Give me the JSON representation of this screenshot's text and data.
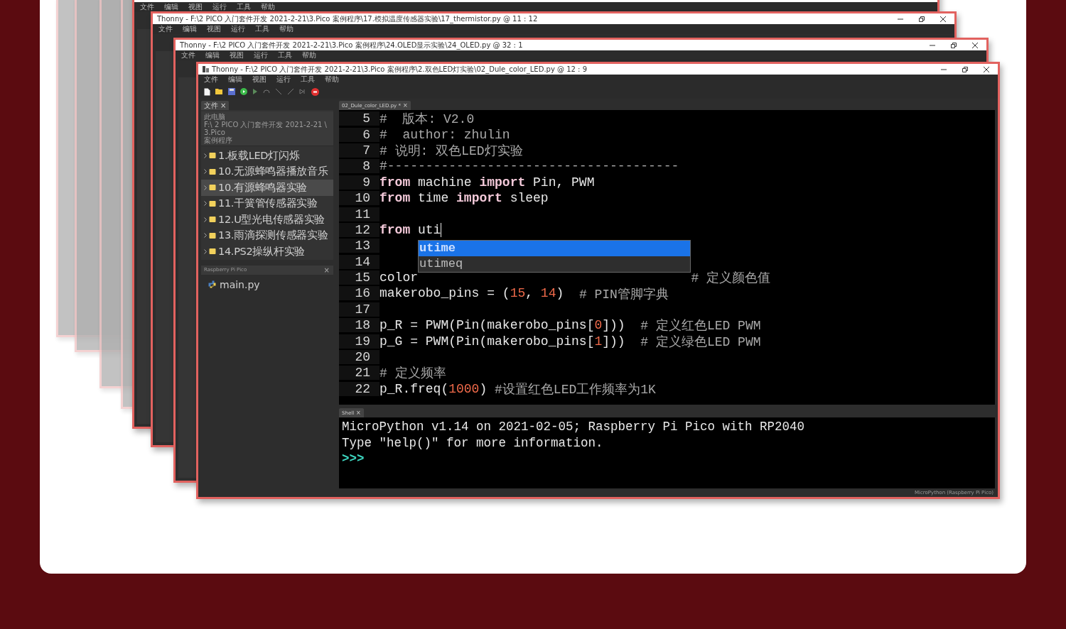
{
  "background_windows": [
    {
      "menu": [
        "文件",
        "编辑",
        "视图",
        "运行",
        "工具",
        "帮助"
      ]
    },
    {
      "title": "Thonny - F:\\2 PICO 入门套件开发 2021-2-21\\3.Pico 案例程序\\17.模拟温度传感器实验\\17_thermistor.py @ 11 : 12",
      "menu": [
        "文件",
        "编辑",
        "视图",
        "运行",
        "工具",
        "帮助"
      ]
    },
    {
      "title": "Thonny - F:\\2 PICO 入门套件开发 2021-2-21\\3.Pico 案例程序\\24.OLED显示实验\\24_OLED.py @ 32 : 1",
      "menu": [
        "文件",
        "编辑",
        "视图",
        "运行",
        "工具",
        "帮助"
      ]
    }
  ],
  "window": {
    "title": "Thonny - F:\\2 PICO 入门套件开发 2021-2-21\\3.Pico 案例程序\\2.双色LED灯实验\\02_Dule_color_LED.py @ 12 : 9",
    "menu": [
      "文件",
      "编辑",
      "视图",
      "运行",
      "工具",
      "帮助"
    ],
    "file_panel": {
      "tab": "文件",
      "close": "×",
      "location_title": "此电脑",
      "location_path": "F:\\ 2 PICO 入门套件开发 2021-2-21 \\ 3.Pico",
      "location_path_2": "案例程序",
      "items": [
        {
          "label": "1.板载LED灯闪烁",
          "selected": false
        },
        {
          "label": "10.无源蜂鸣器播放音乐",
          "selected": false
        },
        {
          "label": "10.有源蜂鸣器实验",
          "selected": true
        },
        {
          "label": "11.干簧管传感器实验",
          "selected": false
        },
        {
          "label": "12.U型光电传感器实验",
          "selected": false
        },
        {
          "label": "13.雨滴探测传感器实验",
          "selected": false
        },
        {
          "label": "14.PS2操纵杆实验",
          "selected": false
        }
      ]
    },
    "device_panel": {
      "title": "Raspberry Pi Pico",
      "close": "×",
      "files": [
        "main.py"
      ]
    },
    "editor": {
      "tab": "02_Dule_color_LED.py *",
      "close": "×",
      "lines": [
        {
          "number": "5",
          "tokens": [
            {
              "t": "#  版本: V2.0",
              "kind": "comment"
            }
          ]
        },
        {
          "number": "6",
          "tokens": [
            {
              "t": "#  author: zhulin",
              "kind": "comment"
            }
          ]
        },
        {
          "number": "7",
          "tokens": [
            {
              "t": "# 说明: 双色LED灯实验",
              "kind": "comment"
            }
          ]
        },
        {
          "number": "8",
          "tokens": [
            {
              "t": "#--------------------------------------",
              "kind": "comment"
            }
          ]
        },
        {
          "number": "9",
          "tokens": [
            {
              "t": "from",
              "kind": "keyword"
            },
            {
              "t": " machine ",
              "kind": "text"
            },
            {
              "t": "import",
              "kind": "keyword"
            },
            {
              "t": " Pin, PWM",
              "kind": "text"
            }
          ]
        },
        {
          "number": "10",
          "tokens": [
            {
              "t": "from",
              "kind": "keyword"
            },
            {
              "t": " time ",
              "kind": "text"
            },
            {
              "t": "import",
              "kind": "keyword"
            },
            {
              "t": " sleep",
              "kind": "text"
            }
          ]
        },
        {
          "number": "11"
        },
        {
          "number": "12",
          "cursor": true,
          "tokens": [
            {
              "t": "from ",
              "kind": "keyword"
            },
            {
              "t": "uti",
              "kind": "text",
              "completing": true
            }
          ]
        },
        {
          "number": "13"
        },
        {
          "number": "14"
        },
        {
          "number": "15",
          "covered_gap": true,
          "tokens": [
            {
              "t": "color",
              "kind": "text"
            },
            {
              "t": "# 定义颜色值",
              "kind": "comment"
            }
          ]
        },
        {
          "number": "16",
          "tokens": [
            {
              "t": "makerobo_pins = (",
              "kind": "text"
            },
            {
              "t": "15",
              "kind": "number"
            },
            {
              "t": ", ",
              "kind": "text"
            },
            {
              "t": "14",
              "kind": "number"
            },
            {
              "t": ")  ",
              "kind": "text"
            },
            {
              "t": "# PIN管脚字典",
              "kind": "comment"
            }
          ]
        },
        {
          "number": "17"
        },
        {
          "number": "18",
          "tokens": [
            {
              "t": "p_R = PWM(Pin(makerobo_pins[",
              "kind": "text"
            },
            {
              "t": "0",
              "kind": "number"
            },
            {
              "t": "]))  ",
              "kind": "text"
            },
            {
              "t": "# 定义红色LED PWM",
              "kind": "comment"
            }
          ]
        },
        {
          "number": "19",
          "tokens": [
            {
              "t": "p_G = PWM(Pin(makerobo_pins[",
              "kind": "text"
            },
            {
              "t": "1",
              "kind": "number"
            },
            {
              "t": "]))  ",
              "kind": "text"
            },
            {
              "t": "# 定义绿色LED PWM",
              "kind": "comment"
            }
          ]
        },
        {
          "number": "20"
        },
        {
          "number": "21",
          "tokens": [
            {
              "t": "# 定义频率",
              "kind": "comment"
            }
          ]
        },
        {
          "number": "22",
          "tokens": [
            {
              "t": "p_R.freq(",
              "kind": "text"
            },
            {
              "t": "1000",
              "kind": "number"
            },
            {
              "t": ") ",
              "kind": "text"
            },
            {
              "t": "#设置红色LED工作频率为1K",
              "kind": "comment"
            }
          ]
        }
      ],
      "autocomplete": [
        {
          "label": "utime",
          "selected": true
        },
        {
          "label": "utimeq",
          "selected": false
        }
      ]
    },
    "shell": {
      "tab": "Shell",
      "close": "×",
      "lines": [
        {
          "kind": "output",
          "text": "MicroPython v1.14 on 2021-02-05; Raspberry Pi Pico with RP2040"
        },
        {
          "kind": "output",
          "text": "Type \"help()\" for more information."
        },
        {
          "kind": "prompt",
          "text": ">>>"
        }
      ]
    },
    "status_bar": "MicroPython (Raspberry Pi Pico)"
  }
}
